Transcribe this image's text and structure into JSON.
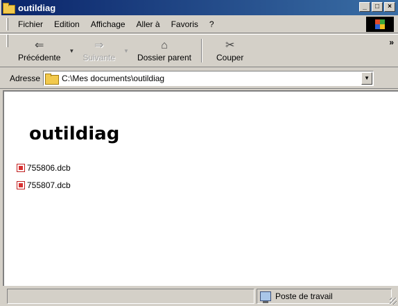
{
  "window": {
    "title": "outildiag",
    "minimize": "_",
    "maximize": "□",
    "close": "×"
  },
  "menu": {
    "items": [
      "Fichier",
      "Edition",
      "Affichage",
      "Aller à",
      "Favoris",
      "?"
    ]
  },
  "toolbar": {
    "back_label": "Précédente",
    "forward_label": "Suivante",
    "up_label": "Dossier parent",
    "cut_label": "Couper",
    "more": "»"
  },
  "address": {
    "label": "Adresse",
    "value": "C:\\Mes documents\\outildiag"
  },
  "content": {
    "folder_title": "outildiag",
    "files": [
      "755806.dcb",
      "755807.dcb"
    ]
  },
  "status": {
    "main_text": "",
    "zone_text": "Poste de travail"
  },
  "icons": {
    "title": "folder-icon",
    "back": "back-arrow-icon",
    "forward": "forward-arrow-icon",
    "up": "folder-up-icon",
    "cut": "scissors-icon",
    "file": "dcb-file-icon",
    "zone": "computer-icon",
    "throbber": "windows-logo-icon"
  }
}
